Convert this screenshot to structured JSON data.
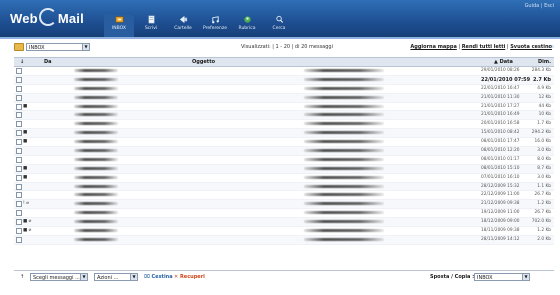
{
  "app": {
    "logo_text_left": "Web",
    "logo_text_right": "Mail",
    "top_right_text": "Guida | Esci"
  },
  "nav": [
    {
      "label": "INBOX",
      "icon": "inbox-icon",
      "color": "#f0a020"
    },
    {
      "label": "Scrivi",
      "icon": "compose-icon",
      "color": "#e8eef6"
    },
    {
      "label": "Cartelle",
      "icon": "folders-icon",
      "color": "#e8eef6"
    },
    {
      "label": "Preferenze",
      "icon": "preferences-icon",
      "color": "#e8eef6"
    },
    {
      "label": "Rubrica",
      "icon": "addressbook-icon",
      "color": "#4caf50"
    },
    {
      "label": "Cerca",
      "icon": "search-icon",
      "color": "#e8eef6"
    }
  ],
  "folder_select": {
    "value": "INBOX"
  },
  "viewing_text": "Visualizzati: | 1 - 20 | di 20 messaggi",
  "top_links": {
    "refresh": "Aggiorna mappa",
    "set_read": "Rendi tutti letti",
    "empty_trash": "Svuota cestino"
  },
  "columns": {
    "sort": "↓",
    "from": "Da",
    "subject": "Oggetto",
    "date": "▲ Data",
    "size": "Dim."
  },
  "messages": [
    {
      "date": "29/01/2010 08:26",
      "size": "284.3 Kb",
      "flags": "",
      "unread": false
    },
    {
      "date": "22/01/2010 07:59",
      "size": "2.7 Kb",
      "flags": "",
      "unread": true
    },
    {
      "date": "22/01/2010 16:47",
      "size": "4.9 Kb",
      "flags": "",
      "unread": false
    },
    {
      "date": "21/01/2010 11:30",
      "size": "12 Kb",
      "flags": "",
      "unread": false
    },
    {
      "date": "21/01/2010 17:27",
      "size": "44 Kb",
      "flags": "■",
      "unread": false
    },
    {
      "date": "21/01/2010 16:49",
      "size": "10 Kb",
      "flags": "",
      "unread": false
    },
    {
      "date": "20/01/2010 16:58",
      "size": "1.7 Kb",
      "flags": "",
      "unread": false
    },
    {
      "date": "15/01/2010 08:42",
      "size": "294.2 Kb",
      "flags": "■",
      "unread": false
    },
    {
      "date": "08/01/2010 17:47",
      "size": "16.0 Kb",
      "flags": "■",
      "unread": false
    },
    {
      "date": "08/01/2010 12:20",
      "size": "3.0 Kb",
      "flags": "",
      "unread": false
    },
    {
      "date": "08/01/2010 01:17",
      "size": "8.0 Kb",
      "flags": "",
      "unread": false
    },
    {
      "date": "08/01/2010 15:10",
      "size": "8.7 Kb",
      "flags": "■",
      "unread": false
    },
    {
      "date": "07/01/2010 16:10",
      "size": "3.0 Kb",
      "flags": "■",
      "unread": false
    },
    {
      "date": "28/12/2009 15:32",
      "size": "1.1 Kb",
      "flags": "",
      "unread": false
    },
    {
      "date": "22/12/2009 11:00",
      "size": "26.7 Kb",
      "flags": "",
      "unread": false
    },
    {
      "date": "21/12/2009 09:38",
      "size": "1.2 Kb",
      "flags": "! ⌀",
      "unread": false
    },
    {
      "date": "19/12/2009 11:00",
      "size": "26.7 Kb",
      "flags": "",
      "unread": false
    },
    {
      "date": "18/12/2009 09:00",
      "size": "702.0 Kb",
      "flags": "■ ⌀",
      "unread": false
    },
    {
      "date": "18/11/2009 09:38",
      "size": "1.2 Kb",
      "flags": "■ ⌀",
      "unread": false
    },
    {
      "date": "28/11/2009 14:12",
      "size": "2.0 Kb",
      "flags": "",
      "unread": false
    }
  ],
  "footer": {
    "sort_arrow": "↑",
    "select_messages": "Scegli messaggi ...",
    "actions": "Azioni ...",
    "delete_label": "Cestina",
    "undelete_label": "Recuperi",
    "move_label": "Sposta / Copia >",
    "move_target": "INBOX"
  }
}
